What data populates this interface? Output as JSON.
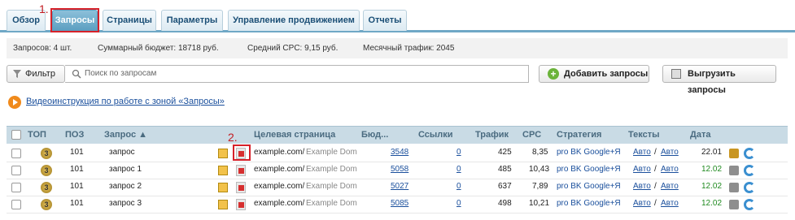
{
  "tabs": [
    {
      "label": "Обзор",
      "active": false
    },
    {
      "label": "Запросы",
      "active": true
    },
    {
      "label": "Страницы",
      "active": false
    },
    {
      "label": "Параметры",
      "active": false
    },
    {
      "label": "Управление продвижением",
      "active": false
    },
    {
      "label": "Отчеты",
      "active": false
    }
  ],
  "annotations": {
    "step1": "1.",
    "step2": "2."
  },
  "stats": {
    "queries": "Запросов: 4 шт.",
    "budget": "Суммарный бюджет: 18718 руб.",
    "cpc": "Средний CPC: 9,15 руб.",
    "traffic": "Месячный трафик: 2045"
  },
  "filter": {
    "label": "Фильтр",
    "search_placeholder": "Поиск по запросам"
  },
  "buttons": {
    "add": "Добавить запросы",
    "export": "Выгрузить запросы"
  },
  "video_link": "Видеоинструкция по работе с зоной «Запросы»",
  "table": {
    "headers": {
      "top": "ТОП",
      "pos": "ПОЗ",
      "query": "Запрос ▲",
      "target": "Целевая страница",
      "budget": "Бюд...",
      "links": "Ссылки",
      "traffic": "Трафик",
      "cpc": "CPC",
      "strategy": "Стратегия",
      "texts": "Тексты",
      "date": "Дата"
    },
    "rows": [
      {
        "top": "3",
        "pos": "101",
        "query": "запрос",
        "url": "example.com/",
        "domain": "Example Dom",
        "budget": "3548",
        "links": "0",
        "traffic": "425",
        "cpc": "8,35",
        "strategy": "pro BK Google+Я",
        "text1": "Авто",
        "sep": "/",
        "text2": "Авто",
        "date": "22.01",
        "date_green": false
      },
      {
        "top": "3",
        "pos": "101",
        "query": "запрос 1",
        "url": "example.com/",
        "domain": "Example Dom",
        "budget": "5058",
        "links": "0",
        "traffic": "485",
        "cpc": "10,43",
        "strategy": "pro BK Google+Я",
        "text1": "Авто",
        "sep": "/",
        "text2": "Авто",
        "date": "12.02",
        "date_green": true
      },
      {
        "top": "3",
        "pos": "101",
        "query": "запрос 2",
        "url": "example.com/",
        "domain": "Example Dom",
        "budget": "5027",
        "links": "0",
        "traffic": "637",
        "cpc": "7,89",
        "strategy": "pro BK Google+Я",
        "text1": "Авто",
        "sep": "/",
        "text2": "Авто",
        "date": "12.02",
        "date_green": true
      },
      {
        "top": "3",
        "pos": "101",
        "query": "запрос 3",
        "url": "example.com/",
        "domain": "Example Dom",
        "budget": "5085",
        "links": "0",
        "traffic": "498",
        "cpc": "10,21",
        "strategy": "pro BK Google+Я",
        "text1": "Авто",
        "sep": "/",
        "text2": "Авто",
        "date": "12.02",
        "date_green": true
      }
    ]
  },
  "colors": {
    "accent": "#5b9ec0",
    "highlight": "#d6212a",
    "link": "#1a4f9c",
    "green": "#1f8a1f"
  }
}
